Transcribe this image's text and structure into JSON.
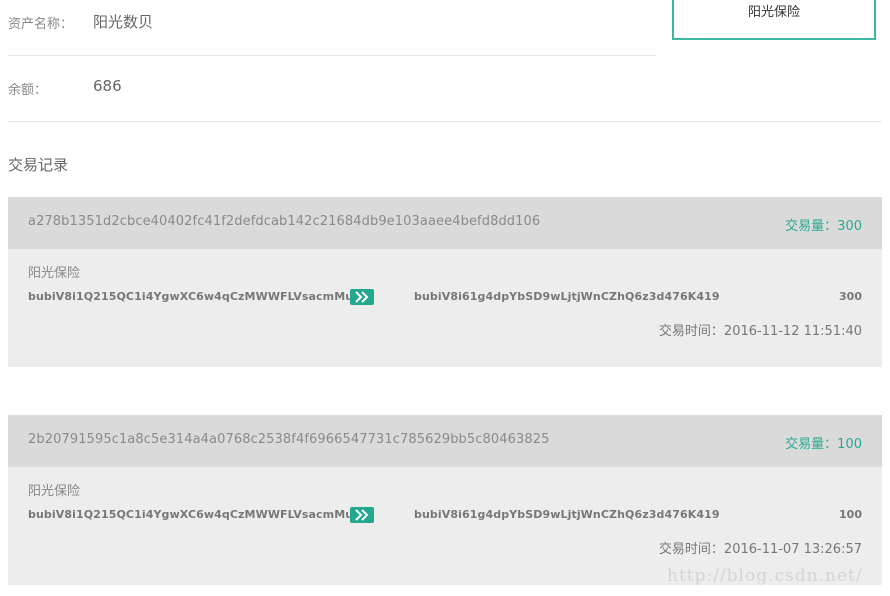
{
  "asset": {
    "label": "资产名称：",
    "value": "阳光数贝"
  },
  "balance": {
    "label": "余额：",
    "value": "686"
  },
  "tag_box": {
    "label": "阳光保险"
  },
  "records": {
    "title": "交易记录",
    "items": [
      {
        "hash": "a278b1351d2cbce40402fc41f2defdcab142c21684db9e103aaee4befd8dd106",
        "amount_label": "交易量：",
        "amount": "300",
        "issuer": "阳光保险",
        "from": "bubiV8i1Q215QC1i4YgwXC6w4qCzMWWFLVsacmMu",
        "to": "bubiV8i61g4dpYbSD9wLjtjWnCZhQ6z3d476K419",
        "qty": "300",
        "time_label": "交易时间：",
        "time": "2016-11-12 11:51:40"
      },
      {
        "hash": "2b20791595c1a8c5e314a4a0768c2538f4f6966547731c785629bb5c80463825",
        "amount_label": "交易量：",
        "amount": "100",
        "issuer": "阳光保险",
        "from": "bubiV8i1Q215QC1i4YgwXC6w4qCzMWWFLVsacmMu",
        "to": "bubiV8i61g4dpYbSD9wLjtjWnCZhQ6z3d476K419",
        "qty": "100",
        "time_label": "交易时间：",
        "time": "2016-11-07 13:26:57"
      }
    ]
  },
  "watermark": "http://blog.csdn.net/",
  "colors": {
    "accent": "#2aa992",
    "header_bg": "#dadada",
    "card_bg": "#ededed"
  },
  "icons": {
    "transfer": "double-chevron-right-icon"
  }
}
